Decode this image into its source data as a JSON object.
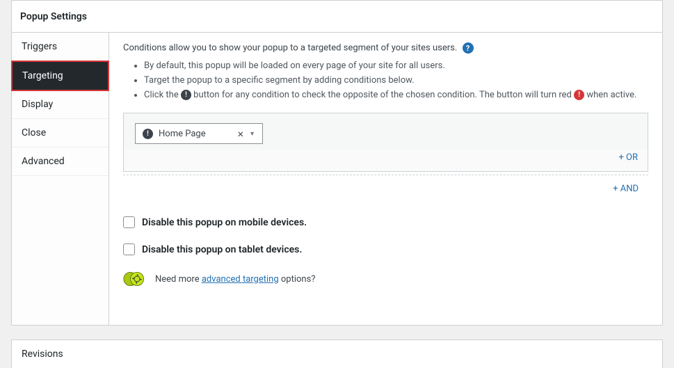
{
  "panel_title": "Popup Settings",
  "tabs": [
    {
      "label": "Triggers",
      "active": false
    },
    {
      "label": "Targeting",
      "active": true
    },
    {
      "label": "Display",
      "active": false
    },
    {
      "label": "Close",
      "active": false
    },
    {
      "label": "Advanced",
      "active": false
    }
  ],
  "intro_text": "Conditions allow you to show your popup to a targeted segment of your sites users.",
  "bullets": {
    "b1": "By default, this popup will be loaded on every page of your site for all users.",
    "b2": "Target the popup to a specific segment by adding conditions below.",
    "b3_prefix": "Click the ",
    "b3_middle": " button for any condition to check the opposite of the chosen condition. The button will turn red ",
    "b3_suffix": " when active."
  },
  "condition_value": "Home Page",
  "or_label": "+ OR",
  "and_label": "+ AND",
  "disable_mobile_label": "Disable this popup on mobile devices.",
  "disable_tablet_label": "Disable this popup on tablet devices.",
  "promo_prefix": "Need more ",
  "promo_link": "advanced targeting",
  "promo_suffix": " options?",
  "revisions_title": "Revisions"
}
